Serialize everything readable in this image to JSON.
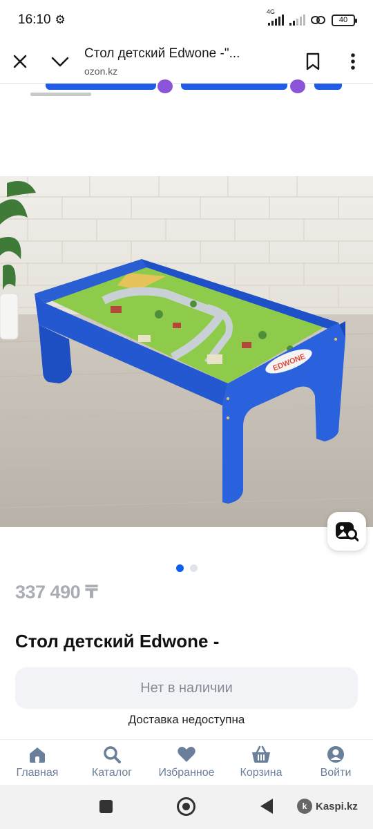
{
  "status_bar": {
    "time": "16:10",
    "network_label": "4G",
    "battery": "40",
    "icons": [
      "gear-icon",
      "signal-icon",
      "link-icon",
      "battery-icon"
    ]
  },
  "browser": {
    "title": "Стол детский Edwone -\"...",
    "url": "ozon.kz",
    "icons": [
      "close-icon",
      "chevron-down-icon",
      "bookmark-icon",
      "more-vert-icon"
    ]
  },
  "product": {
    "price": "337 490 ₸",
    "title": "Стол детский Edwone -",
    "table_logo_text": "EDWONE",
    "image_count": 2,
    "active_image_index": 0
  },
  "actions": {
    "stock_button": "Нет в наличии",
    "delivery_text": "Доставка недоступна"
  },
  "tabs": [
    {
      "label": "Главная",
      "icon": "home-icon"
    },
    {
      "label": "Каталог",
      "icon": "search-icon"
    },
    {
      "label": "Избранное",
      "icon": "heart-icon"
    },
    {
      "label": "Корзина",
      "icon": "basket-icon"
    },
    {
      "label": "Войти",
      "icon": "user-icon"
    }
  ],
  "system_nav": {
    "watermark": "Kaspi.kz"
  },
  "colors": {
    "accent": "#0c5ff0",
    "tab_icon": "#6a7f99",
    "table_blue": "#1e50c8"
  }
}
